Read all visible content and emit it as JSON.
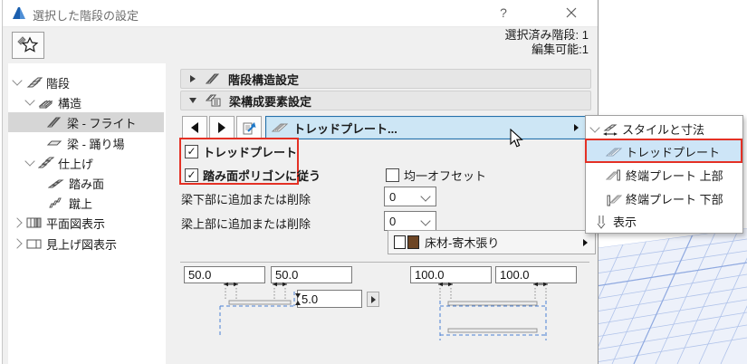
{
  "window": {
    "title": "選択した階段の設定",
    "help": "?",
    "selected_count_label": "選択済み階段: 1",
    "editable_label": "編集可能:1"
  },
  "tree": {
    "items": [
      {
        "label": "階段"
      },
      {
        "label": "構造"
      },
      {
        "label": "梁 - フライト"
      },
      {
        "label": "梁 - 踊り場"
      },
      {
        "label": "仕上げ"
      },
      {
        "label": "踏み面"
      },
      {
        "label": "蹴上"
      },
      {
        "label": "平面図表示"
      },
      {
        "label": "見上げ図表示"
      }
    ]
  },
  "sections": {
    "stair_structure": "階段構造設定",
    "beam_components": "梁構成要素設定"
  },
  "selector": {
    "value": "トレッドプレート..."
  },
  "checkboxes": {
    "check_glyph": "✓",
    "tread_plate": {
      "label": "トレッドプレート",
      "checked": true
    },
    "follow_polygon": {
      "label": "踏み面ポリゴンに従う",
      "checked": true
    },
    "uniform_offset": {
      "label": "均一オフセット",
      "checked": false
    }
  },
  "rows": {
    "bottom": {
      "label": "梁下部に追加または削除",
      "value": "0"
    },
    "top": {
      "label": "梁上部に追加または削除",
      "value": "0"
    }
  },
  "material": {
    "label": "床材-寄木張り"
  },
  "fields": {
    "left1": "50.0",
    "left2": "50.0",
    "offset": "5.0",
    "right1": "100.0",
    "right2": "100.0"
  },
  "popup": {
    "items": [
      "スタイルと寸法",
      "トレッドプレート",
      "終端プレート 上部",
      "終端プレート 下部",
      "表示"
    ]
  },
  "colors": {
    "selection_fill": "#cde6f5",
    "selection_border": "#2670a9",
    "annotation_red": "#e43125",
    "tree_selection": "#d6d6d6",
    "popup_highlight": "#cde5f7"
  }
}
